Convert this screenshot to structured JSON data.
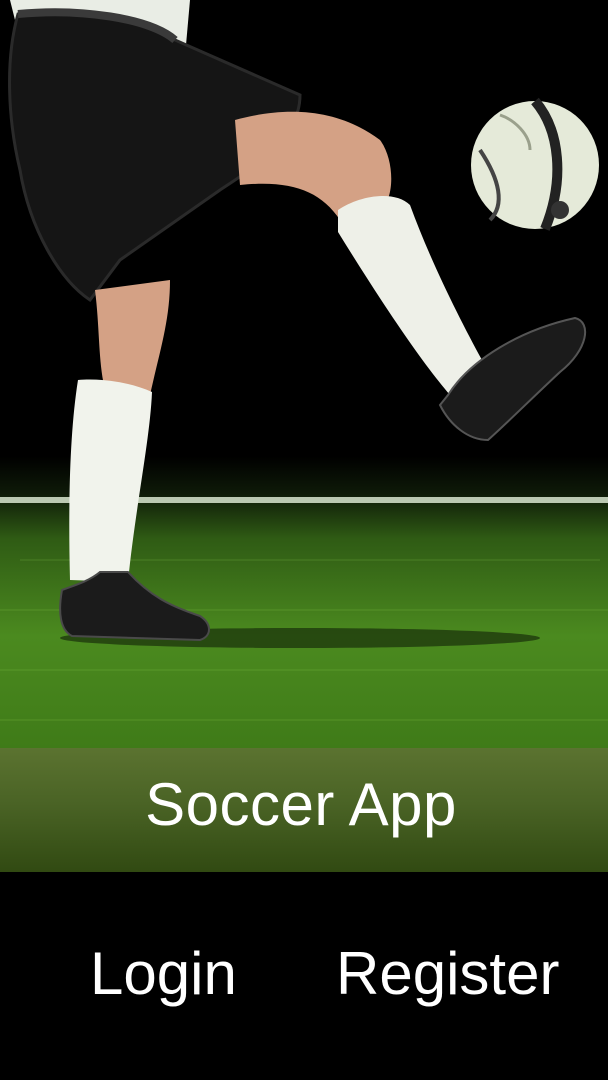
{
  "app": {
    "title": "Soccer App"
  },
  "hero_image": {
    "alt": "Player juggling a soccer ball on a grass pitch at night"
  },
  "actions": {
    "login_label": "Login",
    "register_label": "Register"
  },
  "colors": {
    "background": "#000000",
    "title_band": "#4a6325",
    "text": "#ffffff",
    "grass": "#4b8a1f"
  }
}
